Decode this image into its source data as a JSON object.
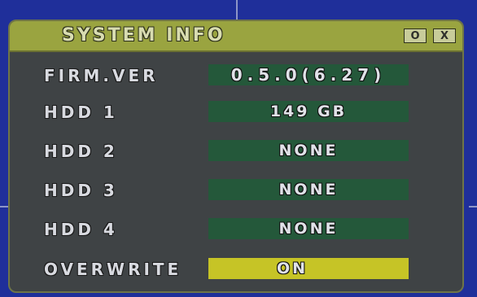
{
  "window": {
    "title": "SYSTEM INFO",
    "button_o": "O",
    "button_x": "X"
  },
  "rows": [
    {
      "label": "FIRM.VER",
      "value": "0.5.0(6.27)"
    },
    {
      "label": "HDD 1",
      "value": "149 GB"
    },
    {
      "label": "HDD 2",
      "value": "NONE"
    },
    {
      "label": "HDD 3",
      "value": "NONE"
    },
    {
      "label": "HDD 4",
      "value": "NONE"
    },
    {
      "label": "OVERWRITE",
      "value": "ON"
    }
  ],
  "colors": {
    "background": "#1f2f9a",
    "panel": "#3f4345",
    "titlebar": "#9aa440",
    "field": "#24583a",
    "field_active": "#c6c426"
  }
}
